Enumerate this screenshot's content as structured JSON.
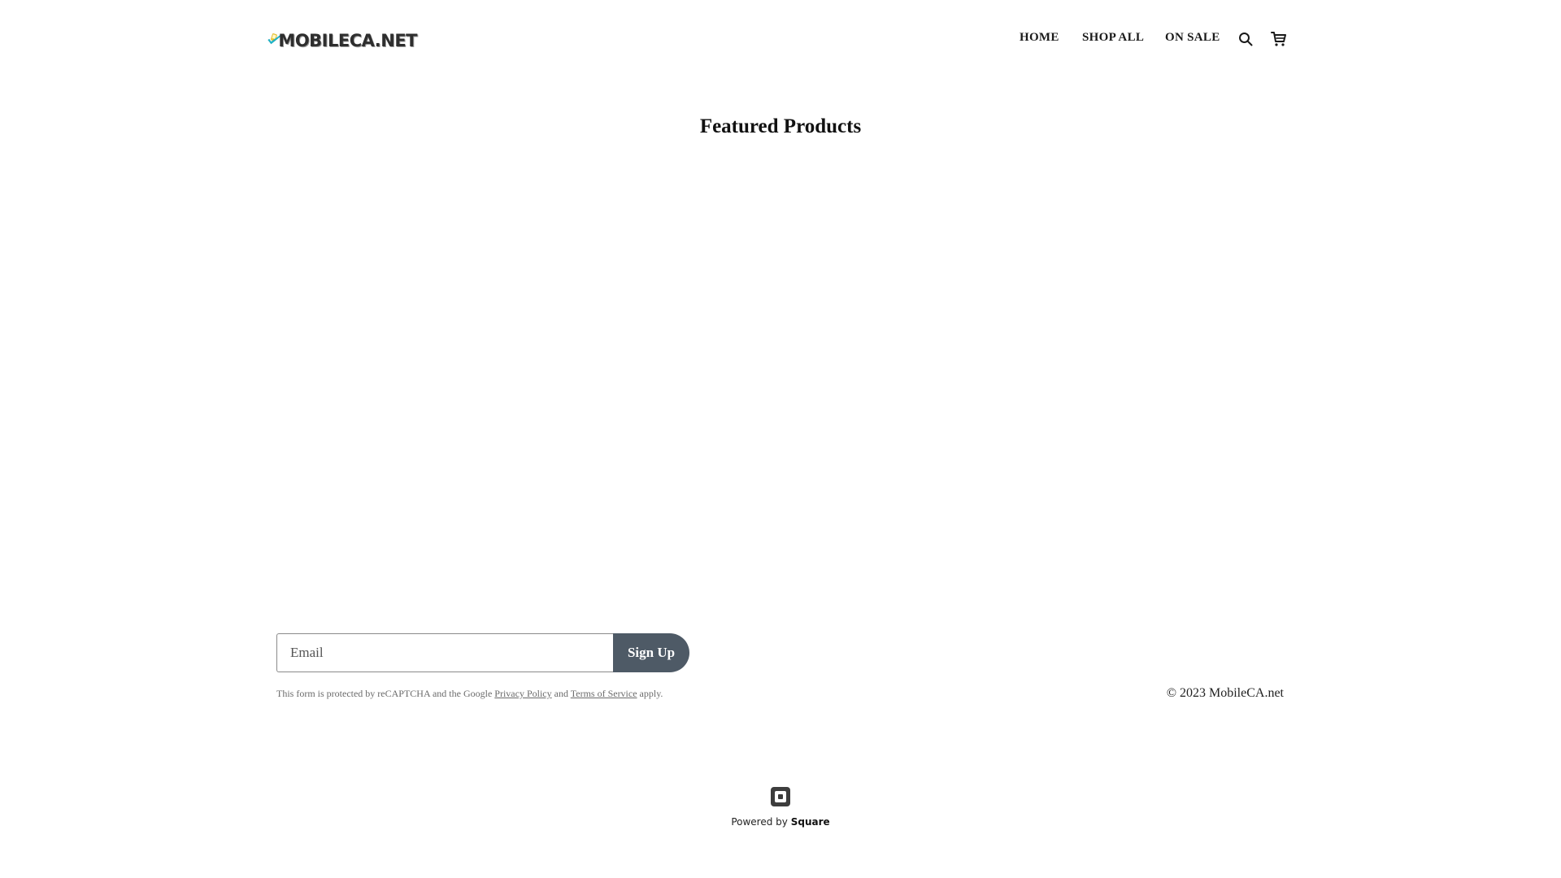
{
  "header": {
    "logo_text": "MOBILECA.NET",
    "nav": [
      {
        "label": "HOME"
      },
      {
        "label": "SHOP ALL"
      },
      {
        "label": "ON SALE"
      }
    ],
    "icons": {
      "search": "search-icon",
      "cart": "cart-icon"
    }
  },
  "main": {
    "section_title": "Featured Products"
  },
  "footer": {
    "email_placeholder": "Email",
    "signup_label": "Sign Up",
    "recaptcha": {
      "prefix": "This form is protected by reCAPTCHA and the Google",
      "privacy_link": "Privacy Policy",
      "and": "and",
      "terms_link": "Terms of Service",
      "suffix": "apply."
    },
    "copyright": "© 2023 MobileCA.net",
    "powered_prefix": "Powered by",
    "powered_brand": "Square"
  },
  "colors": {
    "button_bg": "#4e5a66",
    "logo_teal": "#1bb5c9",
    "logo_yellow": "#f4d03f",
    "text": "#111111"
  }
}
